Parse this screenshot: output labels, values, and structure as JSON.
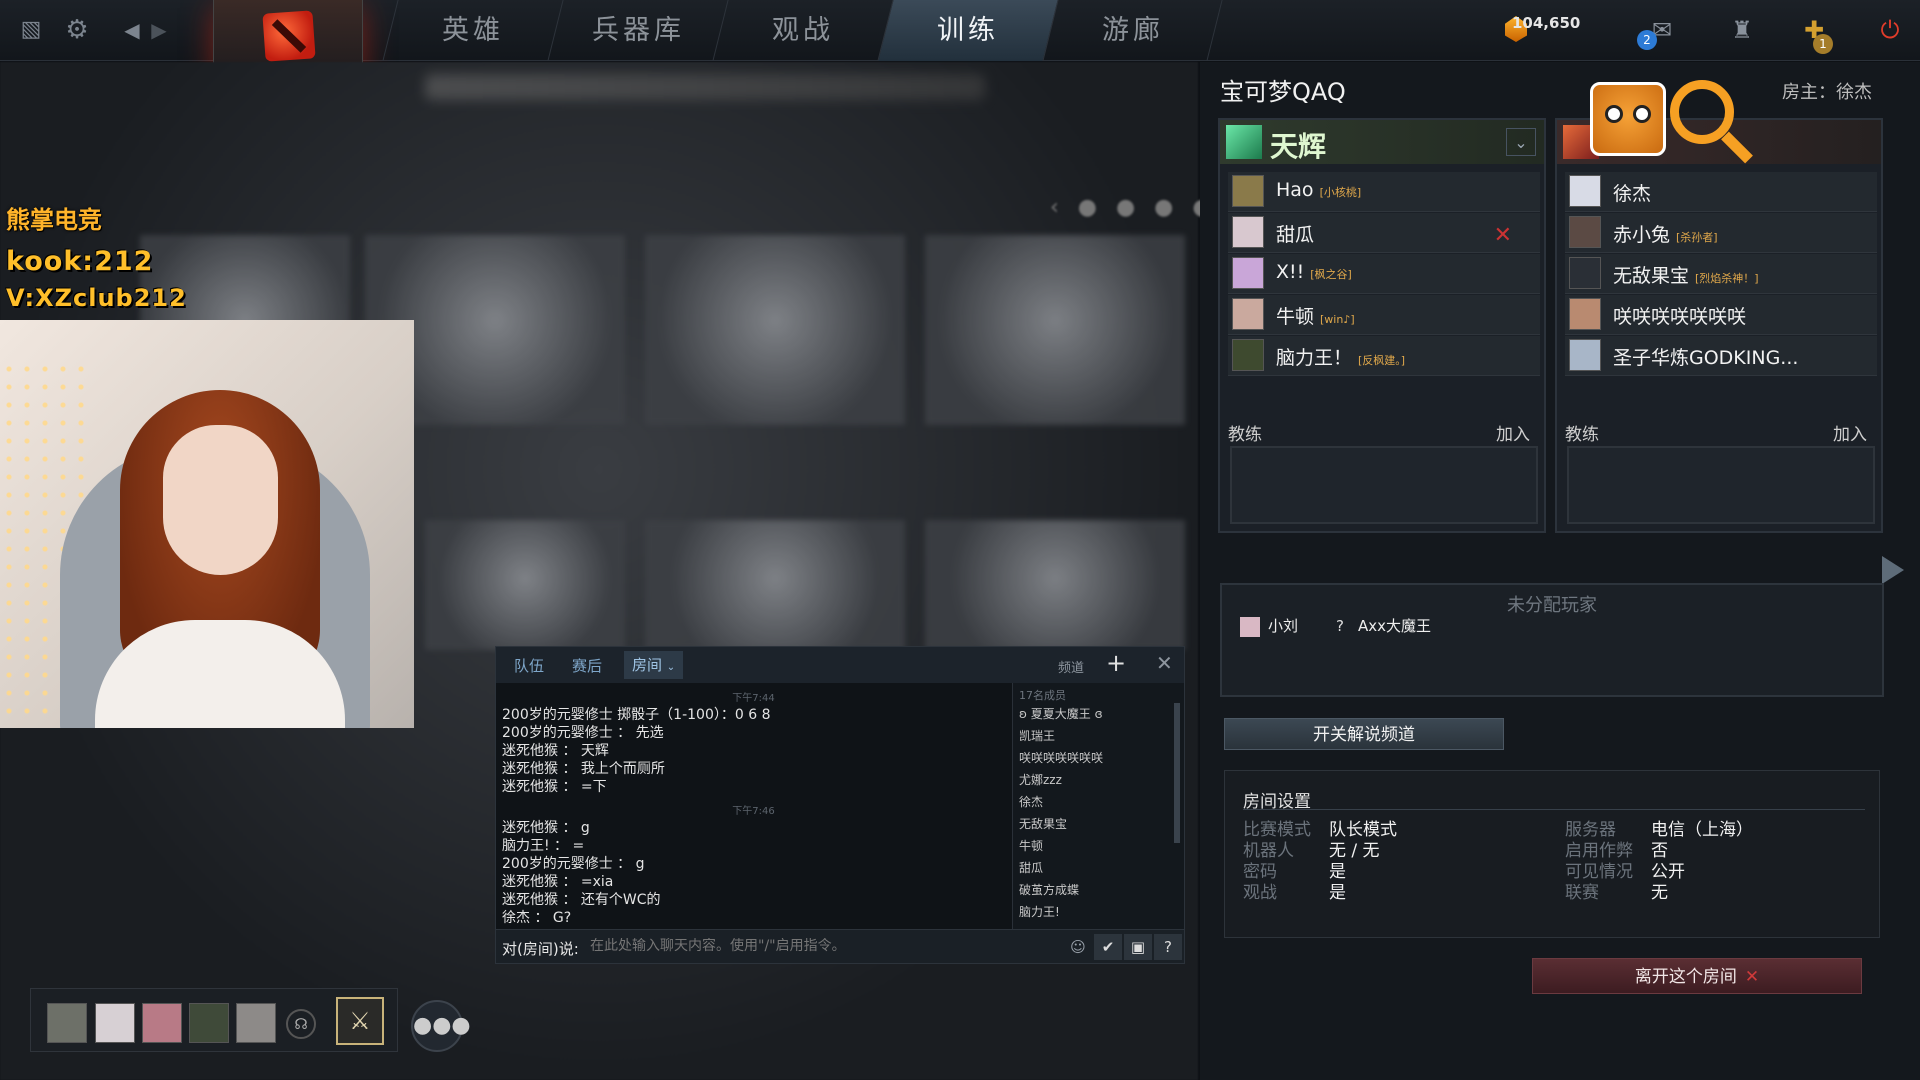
{
  "nav": {
    "tabs": [
      {
        "label": "英雄"
      },
      {
        "label": "兵器库"
      },
      {
        "label": "观战"
      },
      {
        "label": "训练"
      },
      {
        "label": "游廊"
      }
    ],
    "active_tab": "训练",
    "currency": "104,650",
    "mail_badge": "2",
    "plus_badge": "1",
    "icons": [
      "dota-logo-icon",
      "settings-gear-icon",
      "back-arrow-icon",
      "forward-arrow-icon",
      "shards-icon",
      "mail-icon",
      "armory-icon",
      "plus-icon",
      "power-icon"
    ]
  },
  "stream_overlay": {
    "brand": "熊掌电竞",
    "line1": "kook:212",
    "line2": "V:XZclub212"
  },
  "chat": {
    "tabs": [
      {
        "label": "队伍"
      },
      {
        "label": "赛后"
      },
      {
        "label": "房间"
      }
    ],
    "active_tab": "房间",
    "channel_label": "频道",
    "messages": [
      {
        "type": "time",
        "text": "下午7:44"
      },
      {
        "type": "msg",
        "text": "200岁的元婴修士 掷骰子（1-100）：0 6 8"
      },
      {
        "type": "msg",
        "text": "200岁的元婴修士 ： 先选"
      },
      {
        "type": "msg",
        "text": "迷死他猴 ： 天辉"
      },
      {
        "type": "msg",
        "text": "迷死他猴 ： 我上个而厕所"
      },
      {
        "type": "msg",
        "text": "迷死他猴 ： =下"
      },
      {
        "type": "time",
        "text": "下午7:46"
      },
      {
        "type": "msg",
        "text": "迷死他猴 ： g"
      },
      {
        "type": "msg",
        "text": "脑力王! ： ="
      },
      {
        "type": "msg",
        "text": "200岁的元婴修士 ： g"
      },
      {
        "type": "msg",
        "text": "迷死他猴 ： =xia"
      },
      {
        "type": "msg",
        "text": "迷死他猴 ： 还有个WC的"
      },
      {
        "type": "msg",
        "text": "徐杰 ： G?"
      }
    ],
    "member_count": "17名成员",
    "members": [
      "ʚ 夏夏大魔王 ɞ",
      "凯瑞王",
      "咲咲咲咲咲咲咲",
      "尤娜zzz",
      "徐杰",
      "无敌果宝",
      "牛顿",
      "甜瓜",
      "破茧方成蝶",
      "脑力王!"
    ],
    "input_prefix": "对(房间)说:",
    "input_placeholder": "在此处输入聊天内容。使用\"/\"启用指令。"
  },
  "lobby": {
    "room_name": "宝可梦QAQ",
    "host": "房主：徐杰",
    "radiant": {
      "label": "天辉",
      "players": [
        {
          "name": "Hao",
          "tag": "[小核桃]",
          "avatar_color": "#8a7a4a"
        },
        {
          "name": "甜瓜",
          "tag": "",
          "avatar_color": "#d8c8cf"
        },
        {
          "name": "X!!",
          "tag": "[枫之谷]",
          "avatar_color": "#c9a6d8"
        },
        {
          "name": "牛顿",
          "tag": "[win♪]",
          "avatar_color": "#caa99e"
        },
        {
          "name": "脑力王！",
          "tag": "[反枫建。]",
          "avatar_color": "#3e4a2f"
        }
      ],
      "coach_label": "教练",
      "join_label": "加入"
    },
    "dire": {
      "players": [
        {
          "name": "徐杰",
          "tag": "",
          "avatar_color": "#d8dbe6"
        },
        {
          "name": "赤小兔",
          "tag": "[杀孙者]",
          "avatar_color": "#5b4a44"
        },
        {
          "name": "无敌果宝",
          "tag": "[烈焰杀神！]",
          "avatar_color": "#2a2f36"
        },
        {
          "name": "咲咲咲咲咲咲咲",
          "tag": "",
          "avatar_color": "#b98a70"
        },
        {
          "name": "圣子华炼GODKING...",
          "tag": "",
          "avatar_color": "#a8b6c8"
        }
      ],
      "coach_label": "教练",
      "join_label": "加入"
    },
    "unassigned": {
      "title": "未分配玩家",
      "players": [
        {
          "name": "小刘",
          "avatar": "avatar"
        },
        {
          "name": "Axx大魔王",
          "avatar": "?"
        }
      ]
    },
    "caster_button": "开关解说频道",
    "settings": {
      "title": "房间设置",
      "left": [
        {
          "k": "比赛模式",
          "v": "队长模式"
        },
        {
          "k": "机器人",
          "v": "无 / 无"
        },
        {
          "k": "密码",
          "v": "是"
        },
        {
          "k": "观战",
          "v": "是"
        }
      ],
      "right": [
        {
          "k": "服务器",
          "v": "电信（上海）"
        },
        {
          "k": "启用作弊",
          "v": "否"
        },
        {
          "k": "可见情况",
          "v": "公开"
        },
        {
          "k": "联赛",
          "v": "无"
        }
      ]
    },
    "leave_button": "离开这个房间"
  },
  "colors": {
    "accent_blue": "#7ea6c9",
    "radiant_green": "#1c7a4c",
    "danger_red": "#d03a3a",
    "currency_gold": "#ffb52e"
  }
}
